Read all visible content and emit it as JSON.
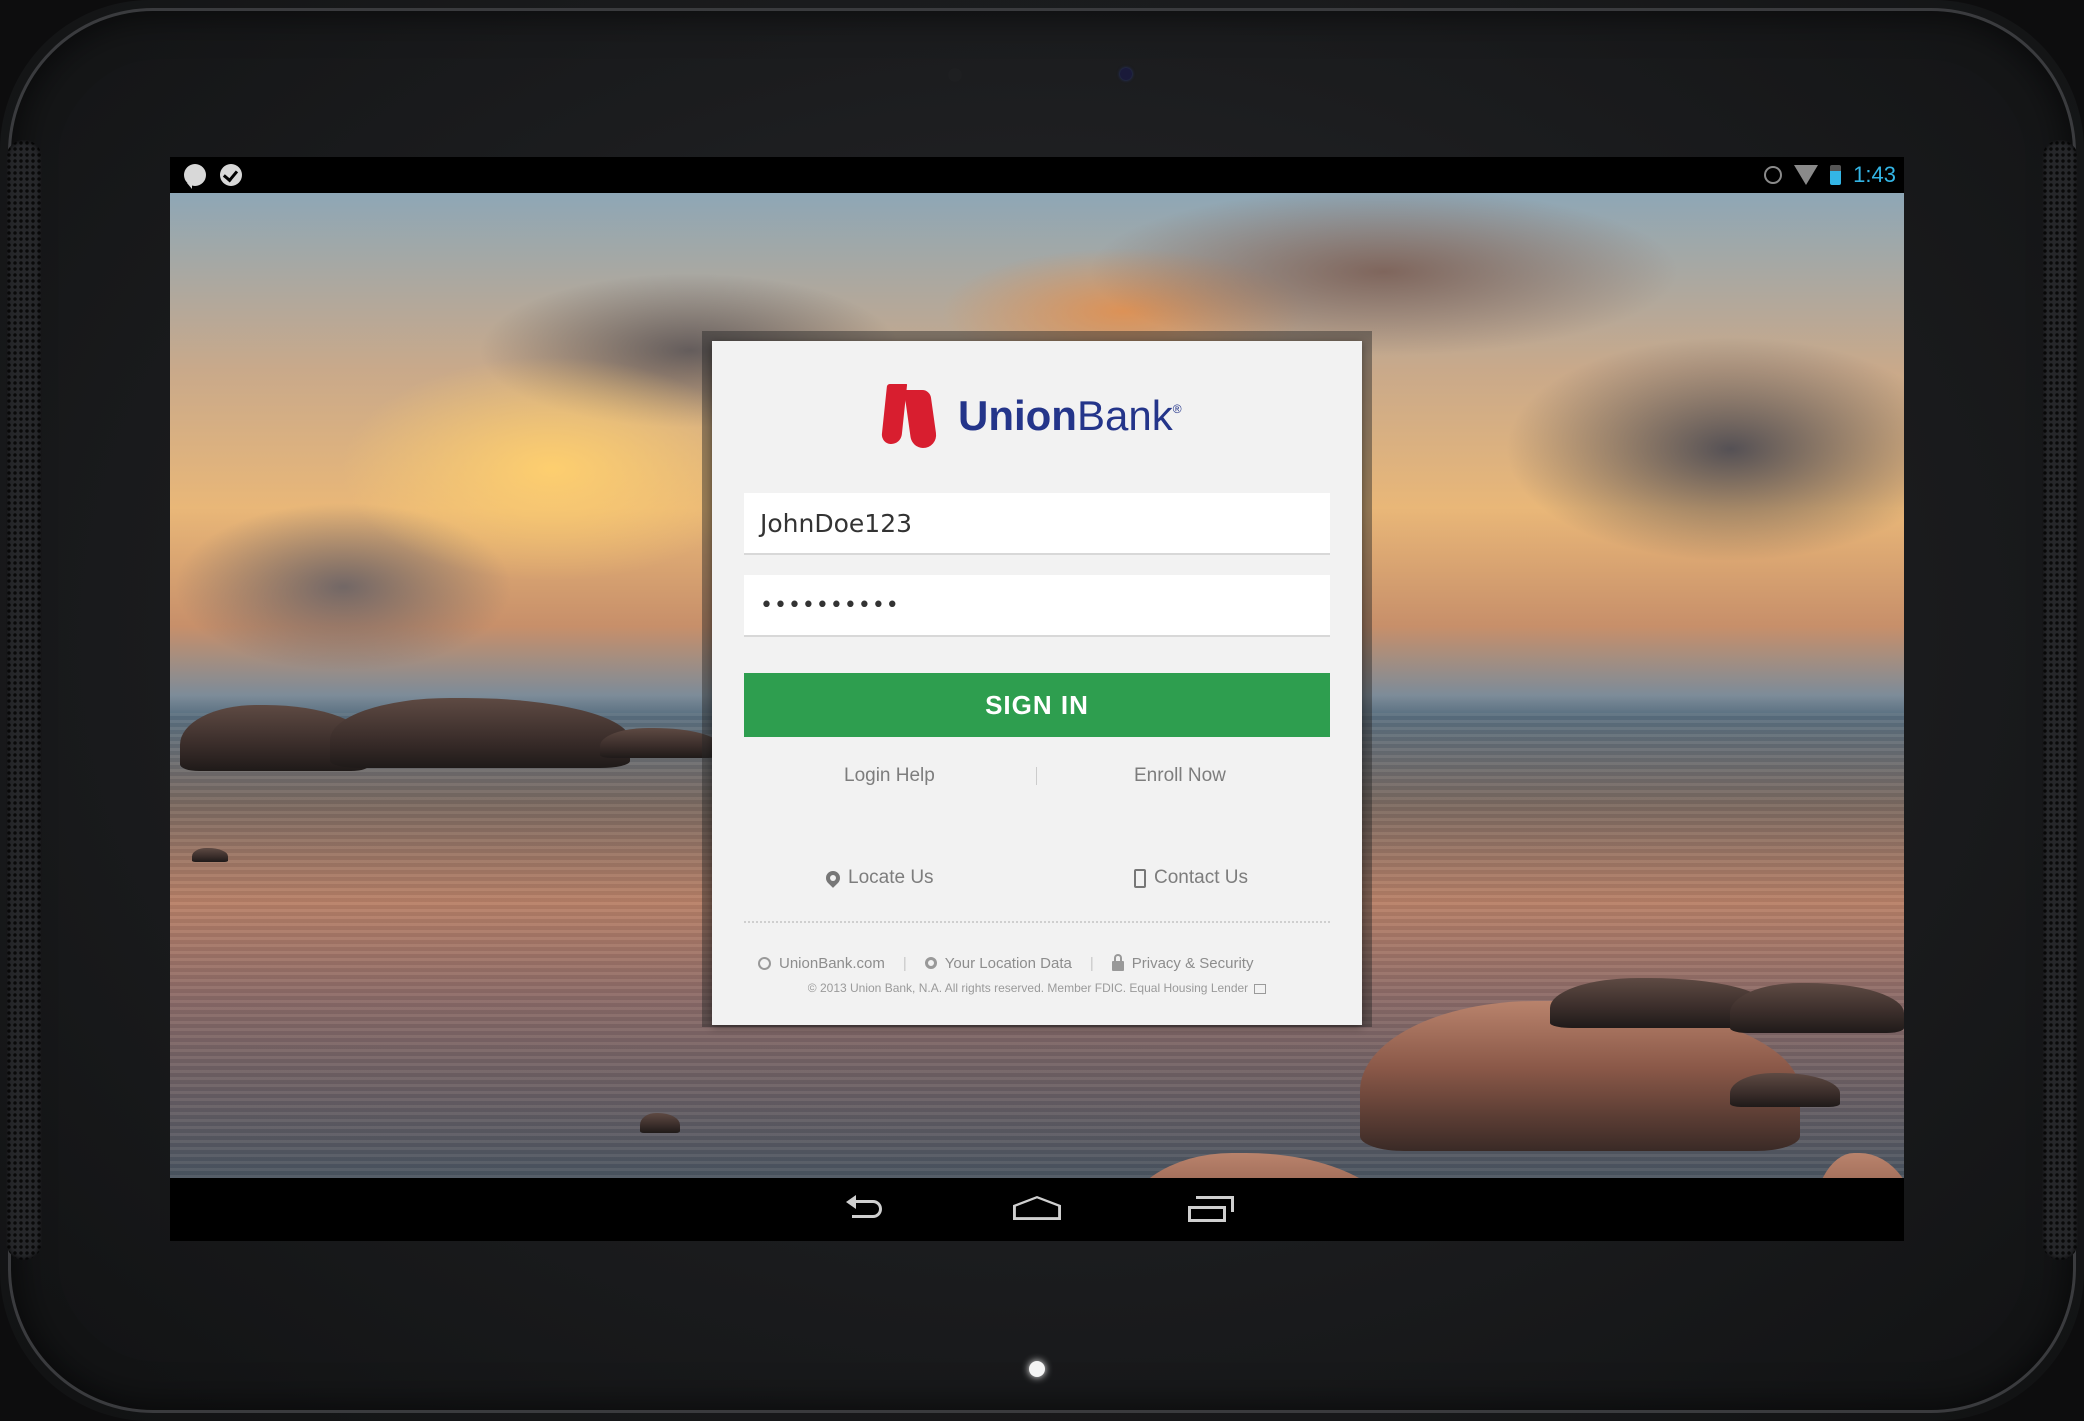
{
  "status_bar": {
    "time": "1:43",
    "left_icons": [
      "chat-notification-icon",
      "task-check-icon"
    ],
    "right_icons": [
      "alarm-icon",
      "wifi-icon",
      "battery-icon"
    ],
    "time_color": "#33b5e5"
  },
  "login": {
    "brand": {
      "name_bold": "Union",
      "name_regular": "Bank",
      "trademark": "®",
      "brand_color": "#24358a",
      "logo_color": "#d81e2f"
    },
    "username_value": "JohnDoe123",
    "password_value": "••••••••••",
    "sign_in_label": "SIGN IN",
    "sign_in_color": "#2e9e4f",
    "login_help_label": "Login Help",
    "enroll_now_label": "Enroll Now",
    "locate_us_label": "Locate Us",
    "contact_us_label": "Contact Us",
    "footer_links": {
      "website": "UnionBank.com",
      "location_data": "Your Location Data",
      "privacy": "Privacy & Security"
    },
    "copyright": "© 2013 Union Bank, N.A. All rights reserved. Member FDIC. Equal Housing Lender"
  },
  "nav_bar": {
    "buttons": [
      "back-icon",
      "home-icon",
      "recent-apps-icon"
    ]
  }
}
